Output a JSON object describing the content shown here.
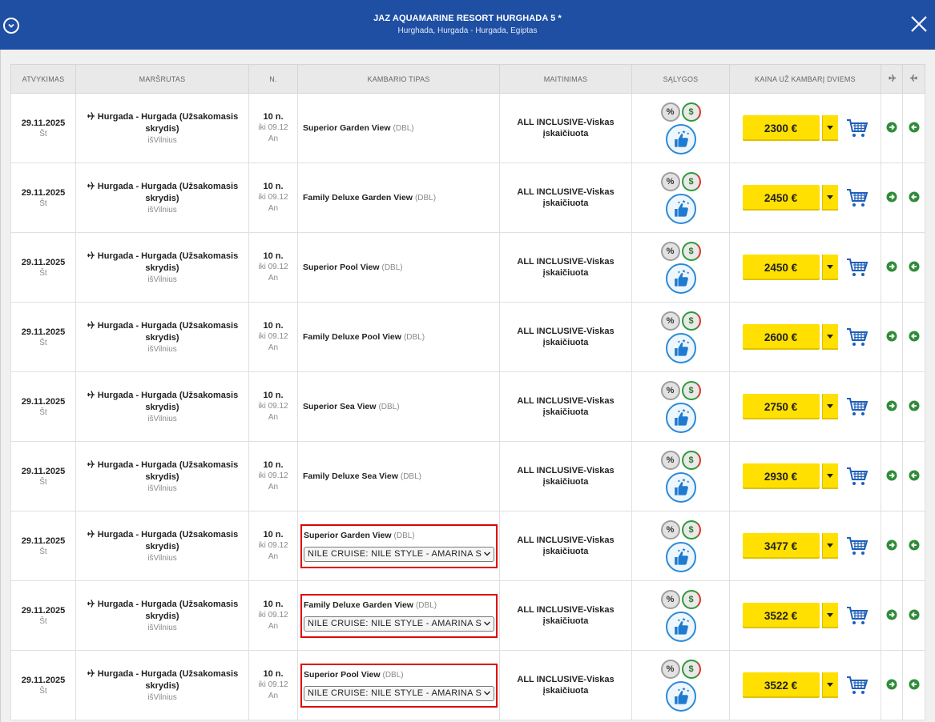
{
  "header": {
    "title": "JAZ AQUAMARINE RESORT HURGHADA 5 *",
    "subtitle": "Hurghada, Hurgada - Hurgada, Egiptas"
  },
  "columns": [
    "ATVYKIMAS",
    "MARŠRUTAS",
    "N.",
    "KAMBARIO TIPAS",
    "MAITINIMAS",
    "SĄLYGOS",
    "KAINA UŽ KAMBARĮ DVIEMS"
  ],
  "icons": {
    "collapse": "chevron-down-circle-icon",
    "close": "close-icon",
    "outbound": "plane-icon",
    "return": "plane-return-icon",
    "discount": "percent-icon",
    "payment": "dollar-icon",
    "rating": "thumbs-up-icon",
    "cart": "cart-icon",
    "forward": "arrow-right-circle-icon",
    "back": "arrow-left-circle-icon"
  },
  "colors": {
    "header_bg": "#1f4fa3",
    "price_button": "#ffe000",
    "highlight_border": "#e00000",
    "green_icon": "#2d9a3a"
  },
  "rows": [
    {
      "date": "29.11.2025",
      "day": "Št",
      "route": "Hurgada - Hurgada (Užsakomasis skrydis)",
      "from": "išVilnius",
      "nights": "10 n.",
      "until": "iki 09.12",
      "until_day": "An",
      "room": "Superior Garden View",
      "room_code": "(DBL)",
      "cruise": "",
      "meal": "ALL INCLUSIVE-Viskas įskaičiuota",
      "price": "2300 €"
    },
    {
      "date": "29.11.2025",
      "day": "Št",
      "route": "Hurgada - Hurgada (Užsakomasis skrydis)",
      "from": "išVilnius",
      "nights": "10 n.",
      "until": "iki 09.12",
      "until_day": "An",
      "room": "Family Deluxe Garden View",
      "room_code": "(DBL)",
      "cruise": "",
      "meal": "ALL INCLUSIVE-Viskas įskaičiuota",
      "price": "2450 €"
    },
    {
      "date": "29.11.2025",
      "day": "Št",
      "route": "Hurgada - Hurgada (Užsakomasis skrydis)",
      "from": "išVilnius",
      "nights": "10 n.",
      "until": "iki 09.12",
      "until_day": "An",
      "room": "Superior Pool View",
      "room_code": "(DBL)",
      "cruise": "",
      "meal": "ALL INCLUSIVE-Viskas įskaičiuota",
      "price": "2450 €"
    },
    {
      "date": "29.11.2025",
      "day": "Št",
      "route": "Hurgada - Hurgada (Užsakomasis skrydis)",
      "from": "išVilnius",
      "nights": "10 n.",
      "until": "iki 09.12",
      "until_day": "An",
      "room": "Family Deluxe Pool View",
      "room_code": "(DBL)",
      "cruise": "",
      "meal": "ALL INCLUSIVE-Viskas įskaičiuota",
      "price": "2600 €"
    },
    {
      "date": "29.11.2025",
      "day": "Št",
      "route": "Hurgada - Hurgada (Užsakomasis skrydis)",
      "from": "išVilnius",
      "nights": "10 n.",
      "until": "iki 09.12",
      "until_day": "An",
      "room": "Superior Sea View",
      "room_code": "(DBL)",
      "cruise": "",
      "meal": "ALL INCLUSIVE-Viskas įskaičiuota",
      "price": "2750 €"
    },
    {
      "date": "29.11.2025",
      "day": "Št",
      "route": "Hurgada - Hurgada (Užsakomasis skrydis)",
      "from": "išVilnius",
      "nights": "10 n.",
      "until": "iki 09.12",
      "until_day": "An",
      "room": "Family Deluxe Sea View",
      "room_code": "(DBL)",
      "cruise": "",
      "meal": "ALL INCLUSIVE-Viskas įskaičiuota",
      "price": "2930 €"
    },
    {
      "date": "29.11.2025",
      "day": "Št",
      "route": "Hurgada - Hurgada (Užsakomasis skrydis)",
      "from": "išVilnius",
      "nights": "10 n.",
      "until": "iki 09.12",
      "until_day": "An",
      "room": "Superior Garden View",
      "room_code": "(DBL)",
      "cruise": "NILE CRUISE: NILE STYLE - AMARINA S",
      "meal": "ALL INCLUSIVE-Viskas įskaičiuota",
      "price": "3477 €"
    },
    {
      "date": "29.11.2025",
      "day": "Št",
      "route": "Hurgada - Hurgada (Užsakomasis skrydis)",
      "from": "išVilnius",
      "nights": "10 n.",
      "until": "iki 09.12",
      "until_day": "An",
      "room": "Family Deluxe Garden View",
      "room_code": "(DBL)",
      "cruise": "NILE CRUISE: NILE STYLE - AMARINA S",
      "meal": "ALL INCLUSIVE-Viskas įskaičiuota",
      "price": "3522 €"
    },
    {
      "date": "29.11.2025",
      "day": "Št",
      "route": "Hurgada - Hurgada (Užsakomasis skrydis)",
      "from": "išVilnius",
      "nights": "10 n.",
      "until": "iki 09.12",
      "until_day": "An",
      "room": "Superior Pool View",
      "room_code": "(DBL)",
      "cruise": "NILE CRUISE: NILE STYLE - AMARINA S",
      "meal": "ALL INCLUSIVE-Viskas įskaičiuota",
      "price": "3522 €"
    }
  ]
}
